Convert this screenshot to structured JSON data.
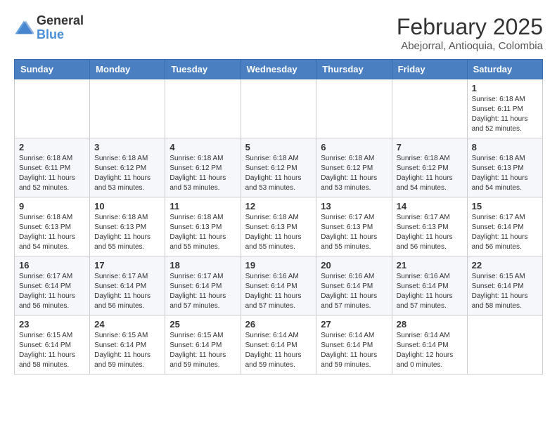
{
  "header": {
    "logo_general": "General",
    "logo_blue": "Blue",
    "month_year": "February 2025",
    "location": "Abejorral, Antioquia, Colombia"
  },
  "weekdays": [
    "Sunday",
    "Monday",
    "Tuesday",
    "Wednesday",
    "Thursday",
    "Friday",
    "Saturday"
  ],
  "weeks": [
    [
      {
        "day": "",
        "info": ""
      },
      {
        "day": "",
        "info": ""
      },
      {
        "day": "",
        "info": ""
      },
      {
        "day": "",
        "info": ""
      },
      {
        "day": "",
        "info": ""
      },
      {
        "day": "",
        "info": ""
      },
      {
        "day": "1",
        "info": "Sunrise: 6:18 AM\nSunset: 6:11 PM\nDaylight: 11 hours and 52 minutes."
      }
    ],
    [
      {
        "day": "2",
        "info": "Sunrise: 6:18 AM\nSunset: 6:11 PM\nDaylight: 11 hours and 52 minutes."
      },
      {
        "day": "3",
        "info": "Sunrise: 6:18 AM\nSunset: 6:12 PM\nDaylight: 11 hours and 53 minutes."
      },
      {
        "day": "4",
        "info": "Sunrise: 6:18 AM\nSunset: 6:12 PM\nDaylight: 11 hours and 53 minutes."
      },
      {
        "day": "5",
        "info": "Sunrise: 6:18 AM\nSunset: 6:12 PM\nDaylight: 11 hours and 53 minutes."
      },
      {
        "day": "6",
        "info": "Sunrise: 6:18 AM\nSunset: 6:12 PM\nDaylight: 11 hours and 53 minutes."
      },
      {
        "day": "7",
        "info": "Sunrise: 6:18 AM\nSunset: 6:12 PM\nDaylight: 11 hours and 54 minutes."
      },
      {
        "day": "8",
        "info": "Sunrise: 6:18 AM\nSunset: 6:13 PM\nDaylight: 11 hours and 54 minutes."
      }
    ],
    [
      {
        "day": "9",
        "info": "Sunrise: 6:18 AM\nSunset: 6:13 PM\nDaylight: 11 hours and 54 minutes."
      },
      {
        "day": "10",
        "info": "Sunrise: 6:18 AM\nSunset: 6:13 PM\nDaylight: 11 hours and 55 minutes."
      },
      {
        "day": "11",
        "info": "Sunrise: 6:18 AM\nSunset: 6:13 PM\nDaylight: 11 hours and 55 minutes."
      },
      {
        "day": "12",
        "info": "Sunrise: 6:18 AM\nSunset: 6:13 PM\nDaylight: 11 hours and 55 minutes."
      },
      {
        "day": "13",
        "info": "Sunrise: 6:17 AM\nSunset: 6:13 PM\nDaylight: 11 hours and 55 minutes."
      },
      {
        "day": "14",
        "info": "Sunrise: 6:17 AM\nSunset: 6:13 PM\nDaylight: 11 hours and 56 minutes."
      },
      {
        "day": "15",
        "info": "Sunrise: 6:17 AM\nSunset: 6:14 PM\nDaylight: 11 hours and 56 minutes."
      }
    ],
    [
      {
        "day": "16",
        "info": "Sunrise: 6:17 AM\nSunset: 6:14 PM\nDaylight: 11 hours and 56 minutes."
      },
      {
        "day": "17",
        "info": "Sunrise: 6:17 AM\nSunset: 6:14 PM\nDaylight: 11 hours and 56 minutes."
      },
      {
        "day": "18",
        "info": "Sunrise: 6:17 AM\nSunset: 6:14 PM\nDaylight: 11 hours and 57 minutes."
      },
      {
        "day": "19",
        "info": "Sunrise: 6:16 AM\nSunset: 6:14 PM\nDaylight: 11 hours and 57 minutes."
      },
      {
        "day": "20",
        "info": "Sunrise: 6:16 AM\nSunset: 6:14 PM\nDaylight: 11 hours and 57 minutes."
      },
      {
        "day": "21",
        "info": "Sunrise: 6:16 AM\nSunset: 6:14 PM\nDaylight: 11 hours and 57 minutes."
      },
      {
        "day": "22",
        "info": "Sunrise: 6:15 AM\nSunset: 6:14 PM\nDaylight: 11 hours and 58 minutes."
      }
    ],
    [
      {
        "day": "23",
        "info": "Sunrise: 6:15 AM\nSunset: 6:14 PM\nDaylight: 11 hours and 58 minutes."
      },
      {
        "day": "24",
        "info": "Sunrise: 6:15 AM\nSunset: 6:14 PM\nDaylight: 11 hours and 59 minutes."
      },
      {
        "day": "25",
        "info": "Sunrise: 6:15 AM\nSunset: 6:14 PM\nDaylight: 11 hours and 59 minutes."
      },
      {
        "day": "26",
        "info": "Sunrise: 6:14 AM\nSunset: 6:14 PM\nDaylight: 11 hours and 59 minutes."
      },
      {
        "day": "27",
        "info": "Sunrise: 6:14 AM\nSunset: 6:14 PM\nDaylight: 11 hours and 59 minutes."
      },
      {
        "day": "28",
        "info": "Sunrise: 6:14 AM\nSunset: 6:14 PM\nDaylight: 12 hours and 0 minutes."
      },
      {
        "day": "",
        "info": ""
      }
    ]
  ]
}
